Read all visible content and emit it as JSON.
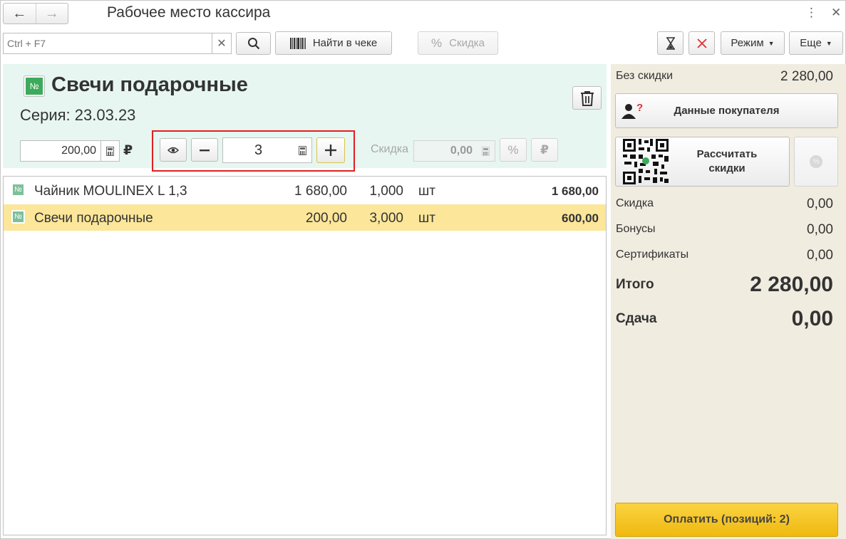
{
  "window": {
    "title": "Рабочее место кассира"
  },
  "toolbar": {
    "search_placeholder": "Ctrl + F7",
    "find_in_receipt_label": "Найти в чеке",
    "discount_label": "Скидка",
    "mode_label": "Режим",
    "more_label": "Еще"
  },
  "product": {
    "tag": "№",
    "title": "Свечи подарочные",
    "series": "Серия: 23.03.23",
    "price": "200,00",
    "currency": "₽",
    "quantity": "3",
    "discount_label": "Скидка",
    "discount_value": "0,00"
  },
  "receipt": {
    "rows": [
      {
        "tag": "№",
        "name": "Чайник MOULINEX L 1,3",
        "price": "1 680,00",
        "qty": "1,000",
        "unit": "шт",
        "sum": "1 680,00",
        "selected": false
      },
      {
        "tag": "№",
        "name": "Свечи подарочные",
        "price": "200,00",
        "qty": "3,000",
        "unit": "шт",
        "sum": "600,00",
        "selected": true
      }
    ]
  },
  "summary": {
    "no_discount_label": "Без скидки",
    "no_discount_value": "2 280,00",
    "customer_data_label": "Данные покупателя",
    "calc_discounts_label_1": "Рассчитать",
    "calc_discounts_label_2": "скидки",
    "discount_label": "Скидка",
    "discount_value": "0,00",
    "bonuses_label": "Бонусы",
    "bonuses_value": "0,00",
    "certificates_label": "Сертификаты",
    "certificates_value": "0,00",
    "total_label": "Итого",
    "total_value": "2 280,00",
    "change_label": "Сдача",
    "change_value": "0,00",
    "pay_label": "Оплатить (позиций: 2)"
  },
  "colors": {
    "product_panel_bg": "#e7f6f0",
    "selected_row_bg": "#fbe69a",
    "right_panel_bg": "#f1ece0",
    "pay_button": "#f5c526",
    "highlight_border": "#e02020",
    "tag_green": "#3cab5c"
  }
}
